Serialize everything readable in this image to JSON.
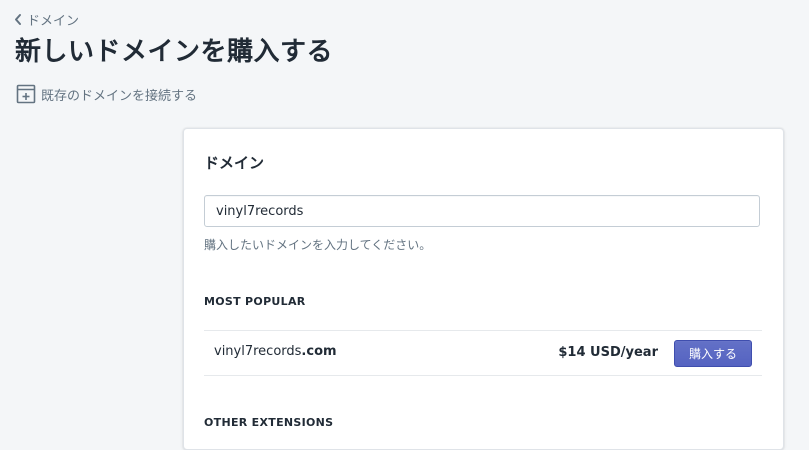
{
  "breadcrumb": {
    "label": "ドメイン",
    "icon": "chevron-left-icon"
  },
  "page_title": "新しいドメインを購入する",
  "connect_existing": {
    "label": "既存のドメインを接続する",
    "icon": "add-window-icon"
  },
  "domain_card": {
    "title": "ドメイン",
    "search_value": "vinyl7records",
    "help_text": "購入したいドメインを入力してください。",
    "most_popular_heading": "MOST POPULAR",
    "results": [
      {
        "name": "vinyl7records",
        "extension": ".com",
        "price": "$14 USD/year",
        "button_label": "購入する"
      }
    ],
    "other_extensions_heading": "OTHER EXTENSIONS"
  },
  "colors": {
    "background": "#f4f6f8",
    "primary_button": "#5c6ac4",
    "text_subdued": "#637381"
  }
}
